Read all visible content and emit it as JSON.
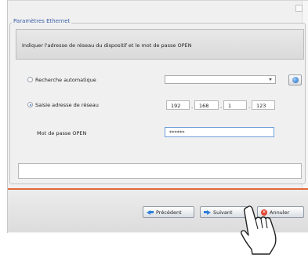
{
  "group_title": "Paramètres Ethernet",
  "instruction": "Indiquer l'adresse de réseau du dispositif et le mot de passe OPEN",
  "options": {
    "auto_label": "Recherche automatique",
    "manual_label": "Saisie adresse de réseau",
    "selected": "manual"
  },
  "ip": [
    "192",
    "168",
    "1",
    "123"
  ],
  "password": {
    "label": "Mot de passe OPEN",
    "value": "******"
  },
  "buttons": {
    "previous": "Précédent",
    "next": "Suivant",
    "cancel": "Annuler"
  },
  "colors": {
    "accent": "#e3683a",
    "title": "#3a5fa8"
  }
}
